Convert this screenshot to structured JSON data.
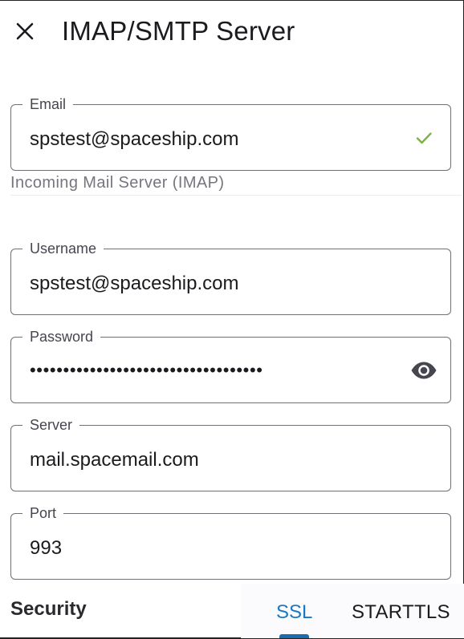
{
  "header": {
    "title": "IMAP/SMTP Server",
    "close_icon": "close-icon"
  },
  "email": {
    "label": "Email",
    "value": "spstest@spaceship.com",
    "status_icon": "check-icon",
    "status_color": "#7cb342"
  },
  "incoming": {
    "section_label": "Incoming Mail Server (IMAP)",
    "username": {
      "label": "Username",
      "value": "spstest@spaceship.com"
    },
    "password": {
      "label": "Password",
      "value": "•••••••••••••••••••••••••••••••••••",
      "toggle_icon": "eye-icon"
    },
    "server": {
      "label": "Server",
      "value": "mail.spacemail.com"
    },
    "port": {
      "label": "Port",
      "value": "993"
    },
    "security": {
      "label": "Security",
      "options": [
        "SSL",
        "STARTTLS"
      ],
      "selected": "SSL",
      "accent_color": "#1a78c2"
    }
  }
}
